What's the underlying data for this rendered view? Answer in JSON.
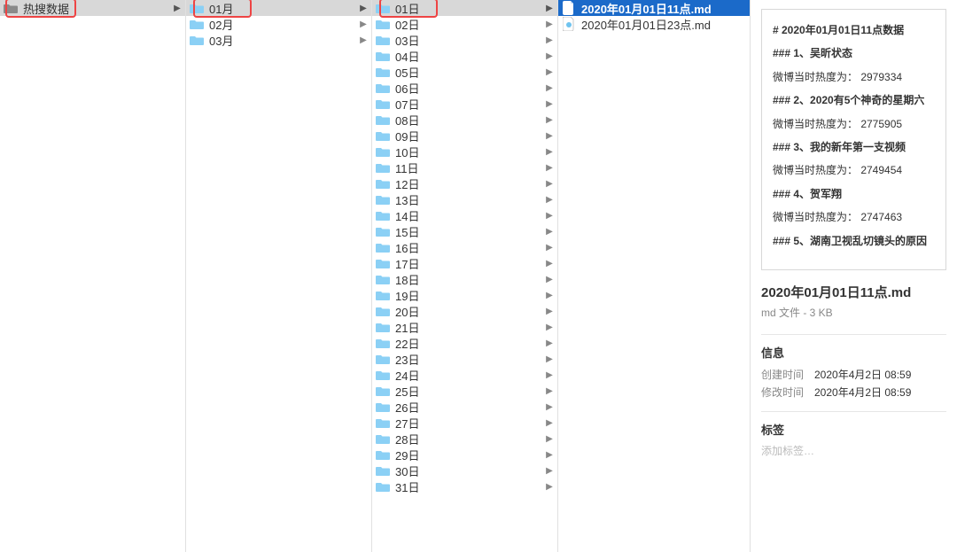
{
  "root": {
    "name": "热搜数据"
  },
  "months": [
    {
      "name": "01月",
      "highlighted": true
    },
    {
      "name": "02月",
      "highlighted": false
    },
    {
      "name": "03月",
      "highlighted": false
    }
  ],
  "days": [
    {
      "name": "01日",
      "highlighted": true
    },
    {
      "name": "02日"
    },
    {
      "name": "03日"
    },
    {
      "name": "04日"
    },
    {
      "name": "05日"
    },
    {
      "name": "06日"
    },
    {
      "name": "07日"
    },
    {
      "name": "08日"
    },
    {
      "name": "09日"
    },
    {
      "name": "10日"
    },
    {
      "name": "11日"
    },
    {
      "name": "12日"
    },
    {
      "name": "13日"
    },
    {
      "name": "14日"
    },
    {
      "name": "15日"
    },
    {
      "name": "16日"
    },
    {
      "name": "17日"
    },
    {
      "name": "18日"
    },
    {
      "name": "19日"
    },
    {
      "name": "20日"
    },
    {
      "name": "21日"
    },
    {
      "name": "22日"
    },
    {
      "name": "23日"
    },
    {
      "name": "24日"
    },
    {
      "name": "25日"
    },
    {
      "name": "26日"
    },
    {
      "name": "27日"
    },
    {
      "name": "28日"
    },
    {
      "name": "29日"
    },
    {
      "name": "30日"
    },
    {
      "name": "31日"
    }
  ],
  "files": [
    {
      "name": "2020年01月01日11点.md",
      "selected": true,
      "kind": "md-blue"
    },
    {
      "name": "2020年01月01日23点.md",
      "selected": false,
      "kind": "md-white"
    }
  ],
  "preview_lines": [
    {
      "t": "#   2020年01月01日11点数据",
      "b": true
    },
    {
      "t": "### 1、吴昕状态",
      "b": true
    },
    {
      "t": "微博当时热度为：  2979334",
      "b": false
    },
    {
      "t": "### 2、2020有5个神奇的星期六",
      "b": true
    },
    {
      "t": "微博当时热度为：  2775905",
      "b": false
    },
    {
      "t": "### 3、我的新年第一支视频",
      "b": true
    },
    {
      "t": "微博当时热度为：  2749454",
      "b": false
    },
    {
      "t": "### 4、贺军翔",
      "b": true
    },
    {
      "t": "微博当时热度为：  2747463",
      "b": false
    },
    {
      "t": "### 5、湖南卫视乱切镜头的原因",
      "b": true
    }
  ],
  "file_title": "2020年01月01日11点.md",
  "file_sub": "md 文件 - 3 KB",
  "info_header": "信息",
  "info_rows": [
    {
      "k": "创建时间",
      "v": "2020年4月2日 08:59"
    },
    {
      "k": "修改时间",
      "v": "2020年4月2日 08:59"
    }
  ],
  "tags_header": "标签",
  "tags_placeholder": "添加标签…",
  "chevron": "▶"
}
